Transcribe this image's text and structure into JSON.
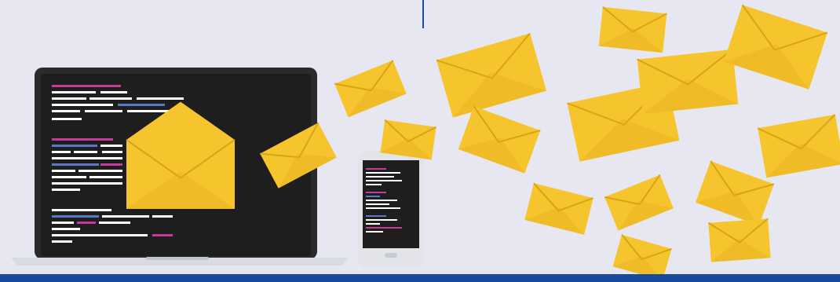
{
  "illustration": {
    "subject": "",
    "colors": {
      "background": "#e6e7f0",
      "envelope_light": "#f6c52e",
      "envelope_dark": "#e2ac1c",
      "envelope_edge": "#d9a316",
      "screen": "#1e1e1e",
      "bezel": "#2a2a2a",
      "laptop_base": "#d9dbe3",
      "phone_body": "#e3e4ea",
      "bar": "#1a4aa0",
      "code_white": "#ffffff",
      "code_pink": "#c43c97",
      "code_blue": "#5a78c8",
      "divider": "#1a4aa0"
    },
    "icons": [
      "laptop-icon",
      "smartphone-icon",
      "envelope-icon"
    ]
  }
}
